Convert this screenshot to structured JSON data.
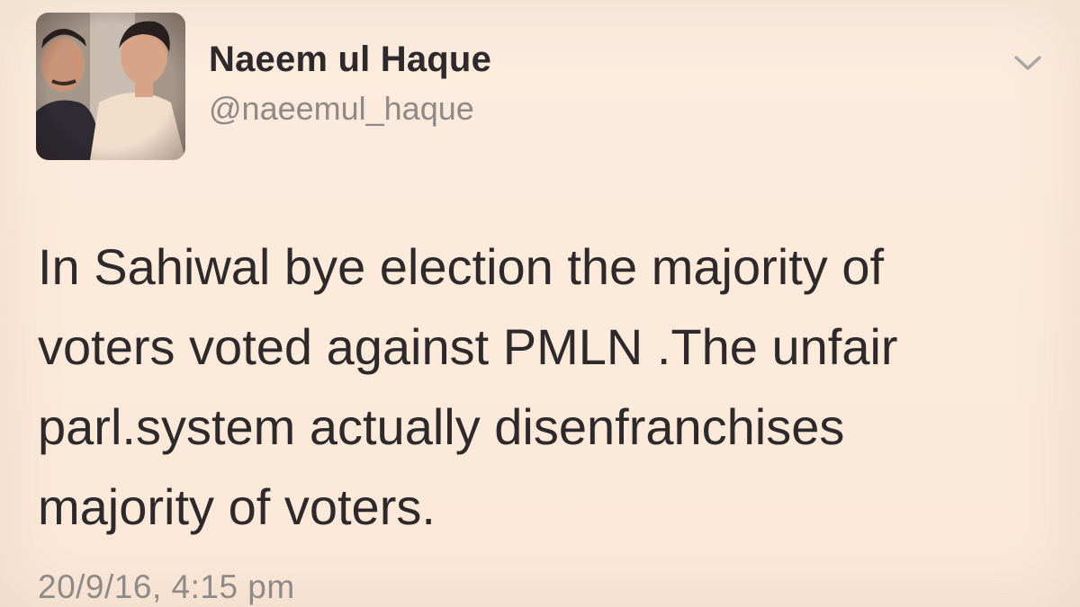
{
  "tweet": {
    "author": {
      "display_name": "Naeem ul Haque",
      "handle": "@naeemul_haque",
      "avatar_icon": "profile-photo"
    },
    "text_lines": [
      "In Sahiwal bye election the majority of",
      "voters voted against PMLN .The unfair",
      "parl.system actually disenfranchises",
      "majority of voters."
    ],
    "timestamp": "20/9/16, 4:15 pm",
    "menu_icon": "chevron-down-icon"
  },
  "colors": {
    "background": "#fbeadb",
    "text_primary": "#2e2a2c",
    "text_secondary": "#8d8a88"
  }
}
